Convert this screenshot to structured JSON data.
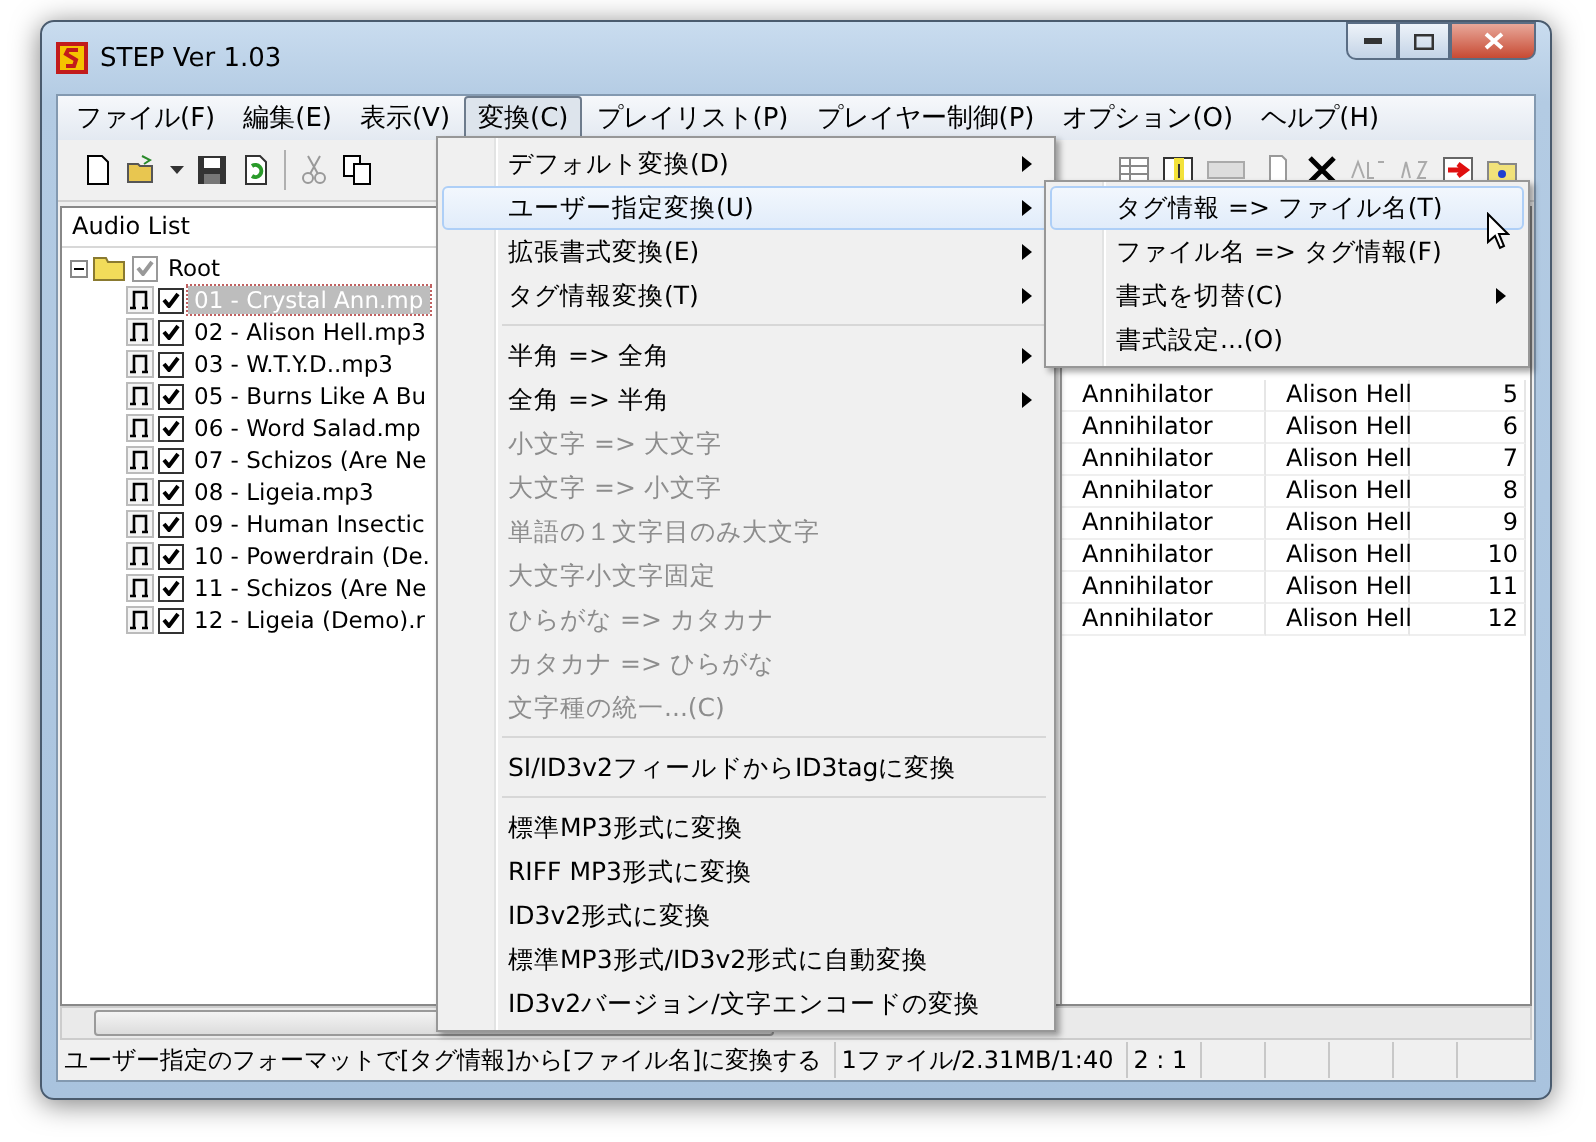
{
  "window": {
    "title": "STEP Ver 1.03"
  },
  "menu_bar": [
    {
      "label": "ファイル(F)",
      "selected": false
    },
    {
      "label": "編集(E)",
      "selected": false
    },
    {
      "label": "表示(V)",
      "selected": false
    },
    {
      "label": "変換(C)",
      "selected": true
    },
    {
      "label": "プレイリスト(P)",
      "selected": false
    },
    {
      "label": "プレイヤー制御(P)",
      "selected": false
    },
    {
      "label": "オプション(O)",
      "selected": false
    },
    {
      "label": "ヘルプ(H)",
      "selected": false
    }
  ],
  "tree": {
    "header": "Audio List",
    "root": {
      "label": "Root",
      "checked": true,
      "expanded": true,
      "children": [
        {
          "label": "01 - Crystal Ann.mp",
          "checked": true,
          "selected": true
        },
        {
          "label": "02 - Alison Hell.mp3",
          "checked": true,
          "selected": false
        },
        {
          "label": "03 - W.T.Y.D..mp3",
          "checked": true,
          "selected": false
        },
        {
          "label": "05 - Burns Like A Bu",
          "checked": true,
          "selected": false
        },
        {
          "label": "06 - Word Salad.mp",
          "checked": true,
          "selected": false
        },
        {
          "label": "07 - Schizos (Are Ne",
          "checked": true,
          "selected": false
        },
        {
          "label": "08 - Ligeia.mp3",
          "checked": true,
          "selected": false
        },
        {
          "label": "09 - Human Insectic",
          "checked": true,
          "selected": false
        },
        {
          "label": "10 - Powerdrain (De.",
          "checked": true,
          "selected": false
        },
        {
          "label": "11 - Schizos (Are Ne",
          "checked": true,
          "selected": false
        },
        {
          "label": "12 - Ligeia (Demo).r",
          "checked": true,
          "selected": false
        }
      ]
    }
  },
  "table": {
    "rows": [
      {
        "artist": "Annihilator",
        "album": "Alison Hell",
        "track": "5"
      },
      {
        "artist": "Annihilator",
        "album": "Alison Hell",
        "track": "6"
      },
      {
        "artist": "Annihilator",
        "album": "Alison Hell",
        "track": "7"
      },
      {
        "artist": "Annihilator",
        "album": "Alison Hell",
        "track": "8"
      },
      {
        "artist": "Annihilator",
        "album": "Alison Hell",
        "track": "9"
      },
      {
        "artist": "Annihilator",
        "album": "Alison Hell",
        "track": "10"
      },
      {
        "artist": "Annihilator",
        "album": "Alison Hell",
        "track": "11"
      },
      {
        "artist": "Annihilator",
        "album": "Alison Hell",
        "track": "12"
      }
    ]
  },
  "dropdown_menu": [
    {
      "kind": "item",
      "label": "デフォルト変換(D)",
      "submenu": true,
      "disabled": false,
      "selected": false
    },
    {
      "kind": "item",
      "label": "ユーザー指定変換(U)",
      "submenu": true,
      "disabled": false,
      "selected": true
    },
    {
      "kind": "item",
      "label": "拡張書式変換(E)",
      "submenu": true,
      "disabled": false,
      "selected": false
    },
    {
      "kind": "item",
      "label": "タグ情報変換(T)",
      "submenu": true,
      "disabled": false,
      "selected": false
    },
    {
      "kind": "separator"
    },
    {
      "kind": "item",
      "label": "半角 => 全角",
      "submenu": true,
      "disabled": false,
      "selected": false
    },
    {
      "kind": "item",
      "label": "全角 => 半角",
      "submenu": true,
      "disabled": false,
      "selected": false
    },
    {
      "kind": "item",
      "label": "小文字 => 大文字",
      "submenu": false,
      "disabled": true,
      "selected": false
    },
    {
      "kind": "item",
      "label": "大文字 => 小文字",
      "submenu": false,
      "disabled": true,
      "selected": false
    },
    {
      "kind": "item",
      "label": "単語の１文字目のみ大文字",
      "submenu": false,
      "disabled": true,
      "selected": false
    },
    {
      "kind": "item",
      "label": "大文字小文字固定",
      "submenu": false,
      "disabled": true,
      "selected": false
    },
    {
      "kind": "item",
      "label": "ひらがな => カタカナ",
      "submenu": false,
      "disabled": true,
      "selected": false
    },
    {
      "kind": "item",
      "label": "カタカナ => ひらがな",
      "submenu": false,
      "disabled": true,
      "selected": false
    },
    {
      "kind": "item",
      "label": "文字種の統一...(C)",
      "submenu": false,
      "disabled": true,
      "selected": false
    },
    {
      "kind": "separator"
    },
    {
      "kind": "item",
      "label": "SI/ID3v2フィールドからID3tagに変換",
      "submenu": false,
      "disabled": false,
      "selected": false
    },
    {
      "kind": "separator"
    },
    {
      "kind": "item",
      "label": "標準MP3形式に変換",
      "submenu": false,
      "disabled": false,
      "selected": false
    },
    {
      "kind": "item",
      "label": "RIFF MP3形式に変換",
      "submenu": false,
      "disabled": false,
      "selected": false
    },
    {
      "kind": "item",
      "label": "ID3v2形式に変換",
      "submenu": false,
      "disabled": false,
      "selected": false
    },
    {
      "kind": "item",
      "label": "標準MP3形式/ID3v2形式に自動変換",
      "submenu": false,
      "disabled": false,
      "selected": false
    },
    {
      "kind": "item",
      "label": "ID3v2バージョン/文字エンコードの変換",
      "submenu": false,
      "disabled": false,
      "selected": false
    }
  ],
  "submenu": [
    {
      "label": "タグ情報 => ファイル名(T)",
      "submenu": false,
      "selected": true
    },
    {
      "label": "ファイル名 => タグ情報(F)",
      "submenu": false,
      "selected": false
    },
    {
      "label": "書式を切替(C)",
      "submenu": true,
      "selected": false
    },
    {
      "label": "書式設定...(O)",
      "submenu": false,
      "selected": false
    }
  ],
  "status_bar": [
    "ユーザー指定のフォーマットで[タグ情報]から[ファイル名]に変換する",
    "1ファイル/2.31MB/1:40",
    "2 : 1"
  ]
}
